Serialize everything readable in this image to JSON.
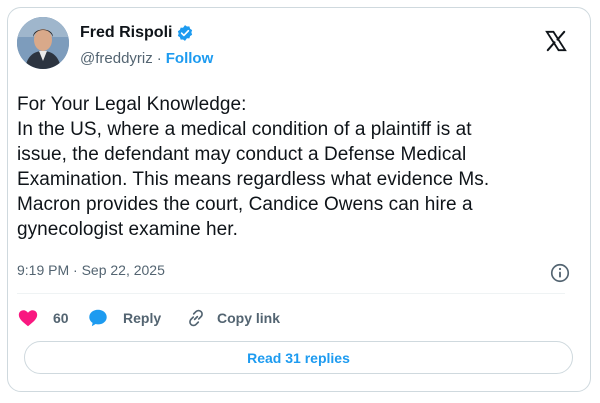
{
  "tweet": {
    "author_name": "Fred Rispoli",
    "handle": "@freddyriz",
    "separator": "·",
    "follow_label": "Follow",
    "text_lines": [
      "For Your Legal Knowledge:",
      "In the US, where a medical condition of a plaintiff is at",
      "issue, the defendant may conduct a Defense Medical",
      "Examination. This means regardless what evidence Ms.",
      "Macron provides the court, Candice Owens can hire a",
      "gynecologist examine her."
    ],
    "timestamp": "9:19 PM · Sep 22, 2025"
  },
  "actions": {
    "like_count": "60",
    "reply_label": "Reply",
    "copy_label": "Copy link"
  },
  "read_replies_label": "Read 31 replies",
  "icons": {
    "verified": "verified-badge-icon",
    "x_logo": "x-logo-icon",
    "info": "info-icon",
    "heart": "heart-icon",
    "reply": "reply-bubble-icon",
    "link": "link-icon"
  },
  "colors": {
    "accent": "#1d9bf0",
    "like": "#f91880",
    "text": "#0f1419",
    "muted": "#536471",
    "border": "#cfd9de"
  }
}
